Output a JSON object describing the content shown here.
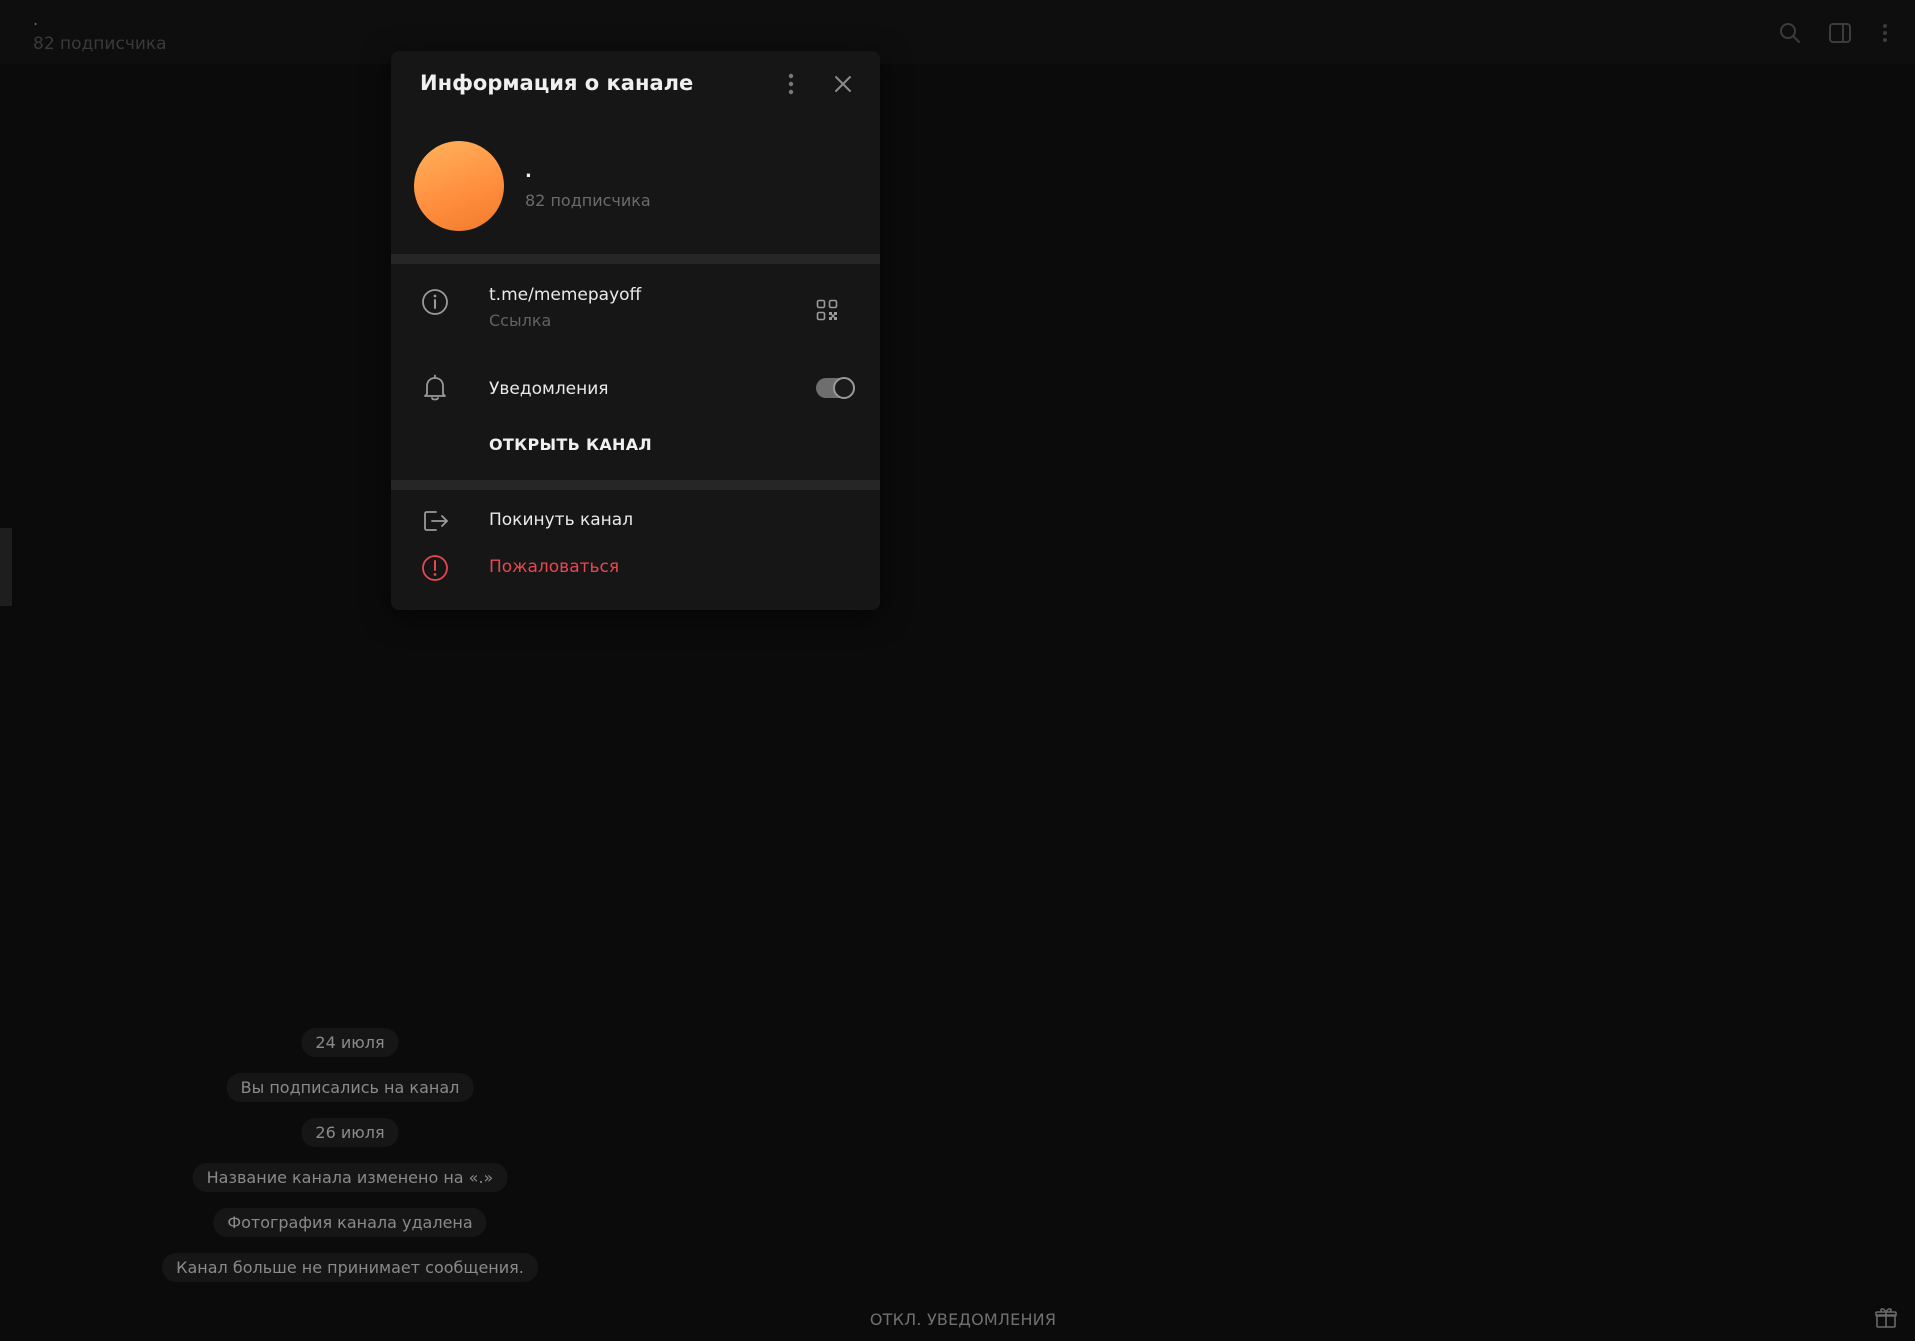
{
  "header": {
    "channel_title": ".",
    "subscribers": "82 подписчика"
  },
  "panel": {
    "title": "Информация о канале",
    "channel_name": ".",
    "subscribers": "82 подписчика",
    "link": "t.me/memepayoff",
    "link_label": "Ссылка",
    "notifications_label": "Уведомления",
    "notifications_on": true,
    "open_channel": "ОТКРЫТЬ КАНАЛ",
    "leave": "Покинуть канал",
    "report": "Пожаловаться",
    "avatar_color": "#ff9a45",
    "report_color": "#e8474f"
  },
  "messages": [
    "24 июля",
    "Вы подписались на канал",
    "26 июля",
    "Название канала изменено на «.»",
    "Фотография канала удалена",
    "Канал больше не принимает сообщения."
  ],
  "bottom_action": "ОТКЛ. УВЕДОМЛЕНИЯ",
  "icons": {
    "search": "search-icon",
    "sidebar": "sidebar-toggle-icon",
    "more": "more-vertical-icon",
    "gift": "gift-icon"
  }
}
